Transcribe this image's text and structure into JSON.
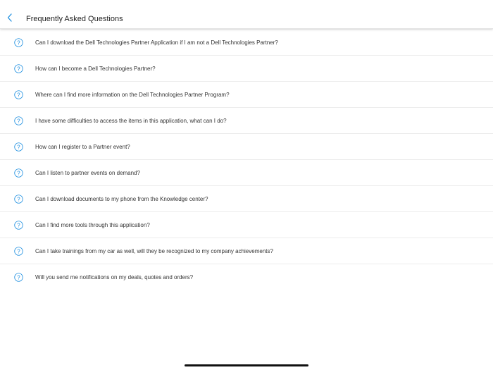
{
  "header": {
    "title": "Frequently Asked Questions",
    "back_icon": "chevron-left-icon"
  },
  "colors": {
    "accent": "#1e8fe0",
    "text": "#333333",
    "divider": "#ececec"
  },
  "faq": {
    "icon": "question-circle-icon",
    "items": [
      {
        "question": "Can I download the Dell Technologies Partner Application if I am not a Dell Technologies Partner?"
      },
      {
        "question": "How can I become a Dell Technologies Partner?"
      },
      {
        "question": "Where can I find more information on the Dell Technologies Partner Program?"
      },
      {
        "question": "I have some difficulties to access the items in this application, what can I do?"
      },
      {
        "question": "How can I register to a Partner event?"
      },
      {
        "question": "Can I listen to partner events on demand?"
      },
      {
        "question": "Can I download documents to my phone from the Knowledge center?"
      },
      {
        "question": "Can I find more tools through this application?"
      },
      {
        "question": "Can I take trainings from my car as well, will they be recognized to my company achievements?"
      },
      {
        "question": "Will you send me notifications on my deals, quotes and orders?"
      }
    ]
  }
}
